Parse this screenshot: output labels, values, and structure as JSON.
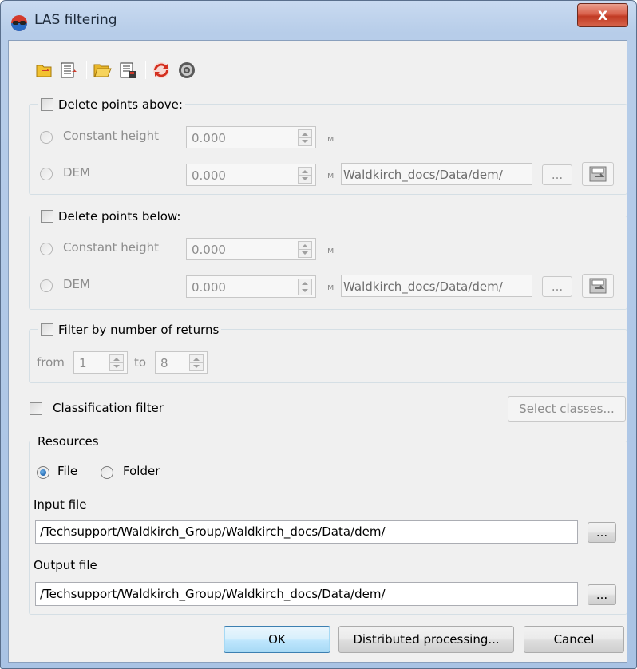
{
  "window": {
    "title": "LAS filtering",
    "close_label": "X"
  },
  "toolbar": {
    "icons": [
      "open-settings-icon",
      "save-settings-icon",
      "open-folder-icon",
      "save-as-icon",
      "refresh-icon",
      "settings-icon"
    ]
  },
  "delete_above": {
    "title": "Delete points above:",
    "constant_label": "Constant height",
    "constant_value": "0.000",
    "dem_label": "DEM",
    "dem_value": "0.000",
    "unit": "м",
    "dem_path": "Waldkirch_docs/Data/dem/",
    "browse_label": "..."
  },
  "delete_below": {
    "title": "Delete points below:",
    "constant_label": "Constant height",
    "constant_value": "0.000",
    "dem_label": "DEM",
    "dem_value": "0.000",
    "unit": "м",
    "dem_path": "Waldkirch_docs/Data/dem/",
    "browse_label": "..."
  },
  "returns_filter": {
    "title": "Filter by number of returns",
    "from_label": "from",
    "from_value": "1",
    "to_label": "to",
    "to_value": "8"
  },
  "classification": {
    "label": "Classification filter",
    "select_button": "Select classes..."
  },
  "resources": {
    "title": "Resources",
    "file_label": "File",
    "folder_label": "Folder",
    "selected": "File",
    "input_label": "Input file",
    "input_value": "/Techsupport/Waldkirch_Group/Waldkirch_docs/Data/dem/",
    "output_label": "Output file",
    "output_value": "/Techsupport/Waldkirch_Group/Waldkirch_docs/Data/dem/",
    "browse_label": "..."
  },
  "buttons": {
    "ok": "OK",
    "distributed": "Distributed processing...",
    "cancel": "Cancel"
  }
}
